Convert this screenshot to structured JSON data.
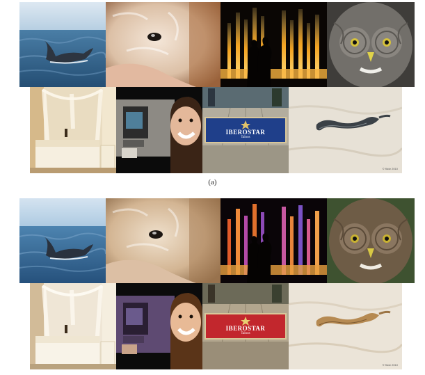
{
  "figure": {
    "subfigure_label_a": "(a)"
  },
  "images": {
    "mat_top_text": "IBEROSTAR",
    "mat_bottom_text": "Taloos",
    "photo_credit": "© flickr 2010"
  },
  "colors": {
    "sea_blue": "#3d6f95",
    "sky": "#c9dceb",
    "fur_light": "#e8d4c0",
    "fountain_gold": "#f0b030",
    "owl_gray": "#6c6a66",
    "mat_blue": "#1f3f8a",
    "mat_red": "#c2272d",
    "sand": "#e9e2d6"
  }
}
